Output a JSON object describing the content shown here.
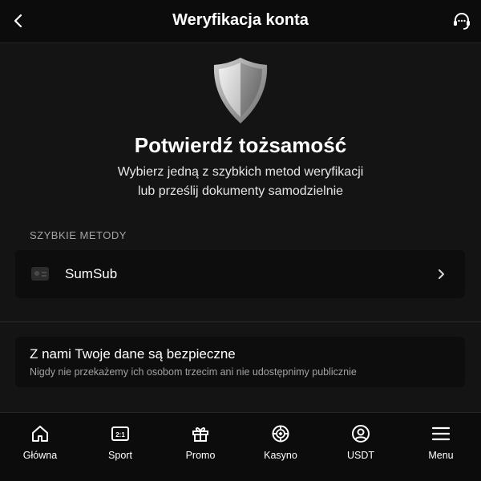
{
  "header": {
    "title": "Weryfikacja konta",
    "back_icon": "chevron-left-icon",
    "support_icon": "headset-icon"
  },
  "hero": {
    "icon": "shield-icon",
    "title": "Potwierdź tożsamość",
    "subtitle_line1": "Wybierz jedną z szybkich metod weryfikacji",
    "subtitle_line2": "lub prześlij dokumenty samodzielnie"
  },
  "quick_methods": {
    "section_label": "SZYBKIE METODY",
    "items": [
      {
        "label": "SumSub",
        "icon": "id-card-icon"
      }
    ]
  },
  "security_notice": {
    "title": "Z nami Twoje dane są bezpieczne",
    "text": "Nigdy nie przekażemy ich osobom trzecim ani nie udostępnimy publicznie"
  },
  "bottom_nav": {
    "items": [
      {
        "label": "Główna",
        "icon": "home-icon"
      },
      {
        "label": "Sport",
        "icon": "scoreboard-icon",
        "icon_text": "2:1"
      },
      {
        "label": "Promo",
        "icon": "gift-icon"
      },
      {
        "label": "Kasyno",
        "icon": "casino-chip-icon"
      },
      {
        "label": "USDT",
        "icon": "user-circle-icon"
      },
      {
        "label": "Menu",
        "icon": "hamburger-menu-icon"
      }
    ]
  },
  "colors": {
    "background": "#141414",
    "header_background": "#0c0c0c",
    "card_background": "#0d0d0d",
    "text_primary": "#ffffff",
    "text_secondary": "#a3a3a3"
  }
}
